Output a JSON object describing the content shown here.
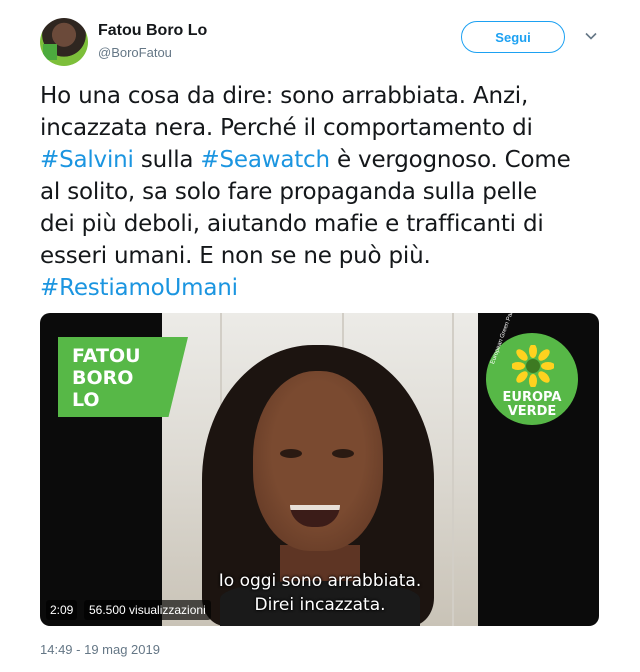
{
  "author": {
    "name": "Fatou Boro Lo",
    "handle": "@BoroFatou",
    "avatar_icon": "profile-photo"
  },
  "follow_button": {
    "label": "Segui",
    "color": "#1da1f2"
  },
  "menu_icon": "chevron-down-icon",
  "tweet": {
    "lines": [
      [
        {
          "text": "Ho una cosa da dire: sono arrabbiata. Anzi,",
          "hashtag": false
        }
      ],
      [
        {
          "text": "incazzata nera. Perché il comportamento di",
          "hashtag": false
        }
      ],
      [
        {
          "text": "#Salvini",
          "hashtag": true
        },
        {
          "text": " sulla ",
          "hashtag": false
        },
        {
          "text": "#Seawatch",
          "hashtag": true
        },
        {
          "text": " è vergognoso. Come",
          "hashtag": false
        }
      ],
      [
        {
          "text": "al solito, sa solo fare propaganda sulla pelle",
          "hashtag": false
        }
      ],
      [
        {
          "text": "dei più deboli, aiutando mafie e trafficanti di",
          "hashtag": false
        }
      ],
      [
        {
          "text": "esseri umani. E non se ne può più.",
          "hashtag": false
        }
      ],
      [
        {
          "text": "#RestiamoUmani",
          "hashtag": true
        }
      ]
    ],
    "hashtag_color": "#1b95e0"
  },
  "video": {
    "banner": [
      "FATOU",
      "BORO",
      "LO"
    ],
    "logo": {
      "top": "EUROPA",
      "bottom": "VERDE",
      "ring": "European Green Party",
      "color": "#57b847"
    },
    "subtitles": [
      "Io oggi sono arrabbiata.",
      "Direi incazzata."
    ],
    "duration": "2:09",
    "views": "56.500 visualizzazioni"
  },
  "timestamp": "14:49 - 19 mag 2019"
}
